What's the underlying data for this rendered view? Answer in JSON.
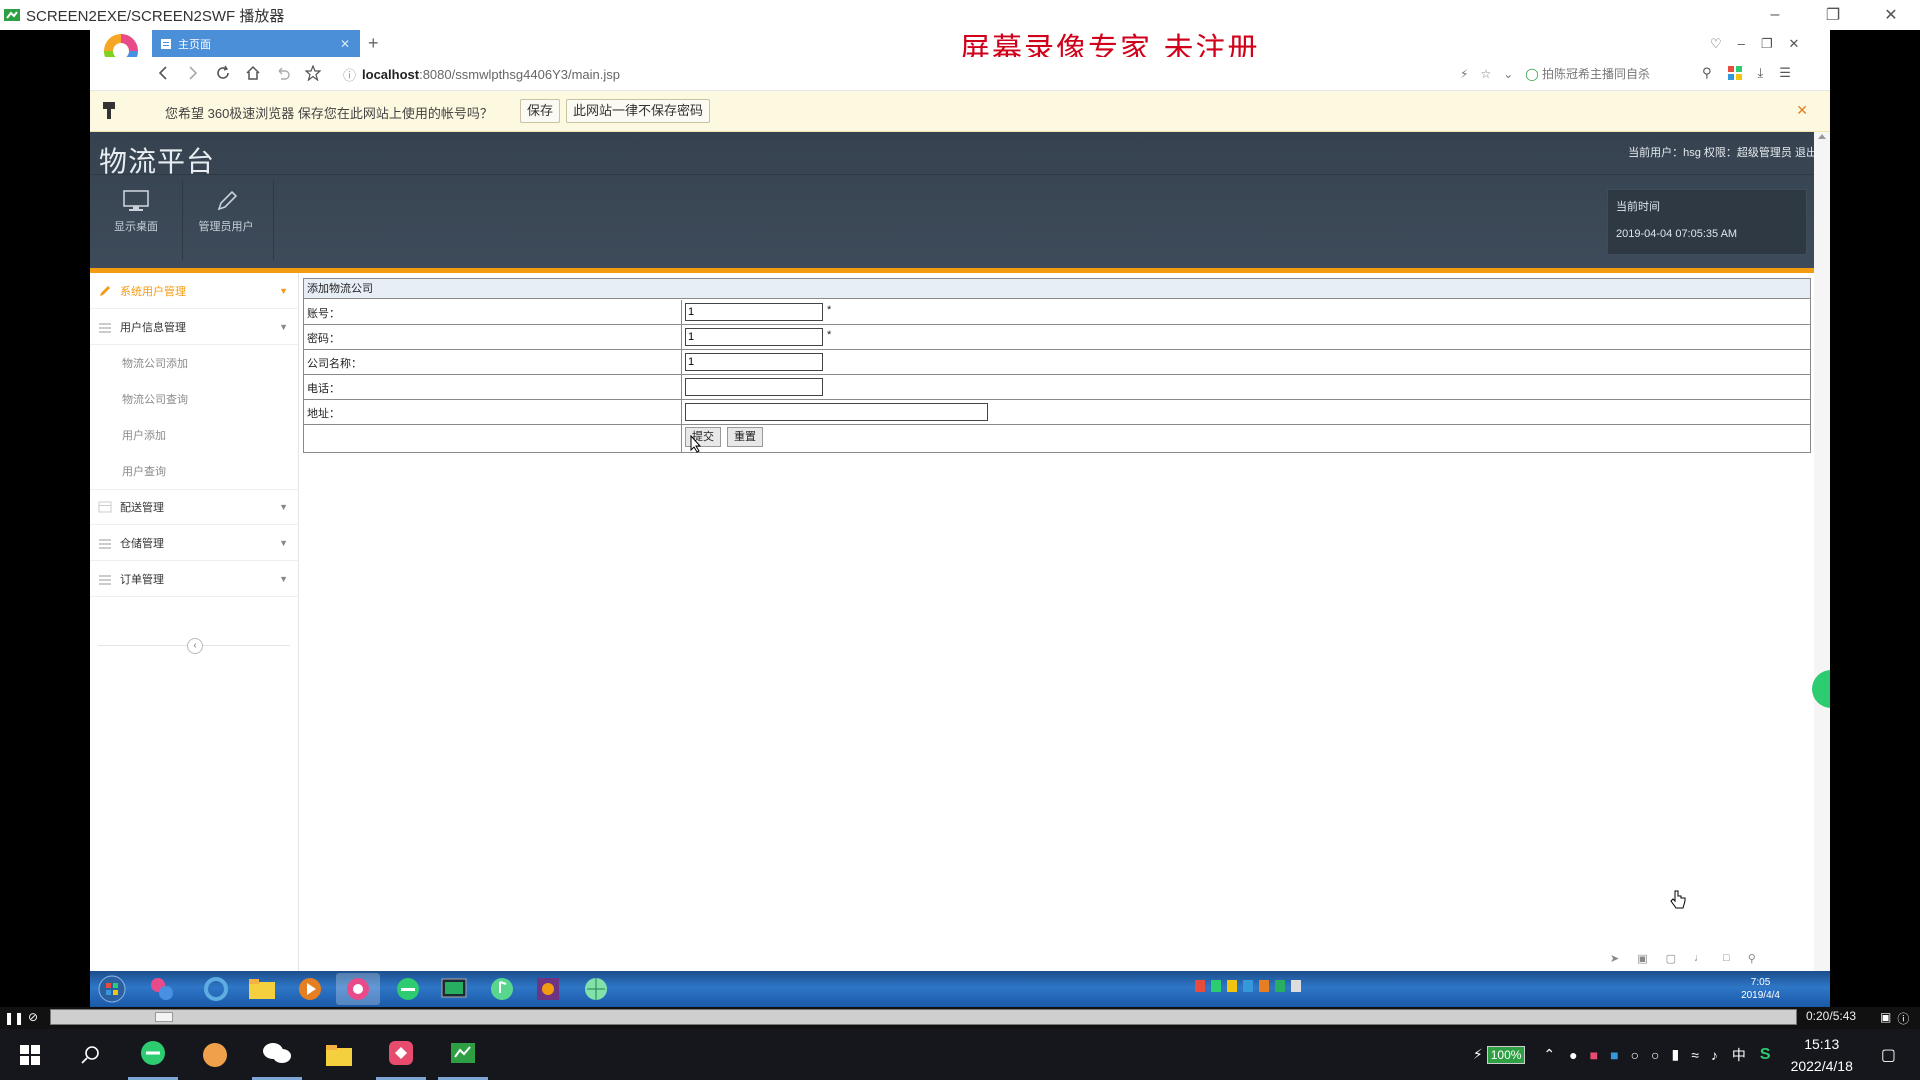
{
  "player": {
    "title": "SCREEN2EXE/SCREEN2SWF 播放器",
    "time": "0:20/5:43",
    "progress": 0.058
  },
  "watermark": "屏幕录像专家  未注册",
  "browser": {
    "tab_title": "主页面",
    "url_host": "localhost",
    "url_path": ":8080/ssmwlpthsg4406Y3/main.jsp",
    "toolbar_hint": "拍陈冠希主播同自杀",
    "password_prompt": "您希望 360极速浏览器 保存您在此网站上使用的帐号吗？",
    "password_save": "保存",
    "password_never": "此网站一律不保存密码"
  },
  "app": {
    "title": "物流平台",
    "userinfo": "当前用户：hsg 权限：超级管理员 退出",
    "toolbar": [
      {
        "label": "显示桌面",
        "icon": "monitor-icon"
      },
      {
        "label": "管理员用户",
        "icon": "pencil-icon"
      }
    ],
    "time_label": "当前时间",
    "time_value": "2019-04-04 07:05:35 AM",
    "sidebar": {
      "sections": [
        {
          "label": "系统用户管理",
          "active": true
        },
        {
          "label": "用户信息管理",
          "active": false
        }
      ],
      "subitems": [
        "物流公司添加",
        "物流公司查询",
        "用户添加",
        "用户查询"
      ],
      "sections_after": [
        "配送管理",
        "仓储管理",
        "订单管理"
      ]
    },
    "form": {
      "title": "添加物流公司",
      "fields": [
        {
          "label": "账号：",
          "value": "1",
          "required": "*"
        },
        {
          "label": "密码：",
          "value": "1",
          "required": "*"
        },
        {
          "label": "公司名称：",
          "value": "1",
          "required": ""
        },
        {
          "label": "电话：",
          "value": "",
          "required": ""
        },
        {
          "label": "地址：",
          "value": "",
          "required": ""
        }
      ],
      "submit": "提交",
      "reset": "重置"
    }
  },
  "recorded_taskbar": {
    "time": "7:05",
    "date": "2019/4/4"
  },
  "windows_taskbar": {
    "time": "15:13",
    "date": "2022/4/18",
    "battery": "100%",
    "ime": "中"
  },
  "colors": {
    "accent_orange": "#f39c12",
    "header_bg": "#3a4756",
    "watermark_red": "#d0021b",
    "tab_blue": "#4a8fd8"
  }
}
